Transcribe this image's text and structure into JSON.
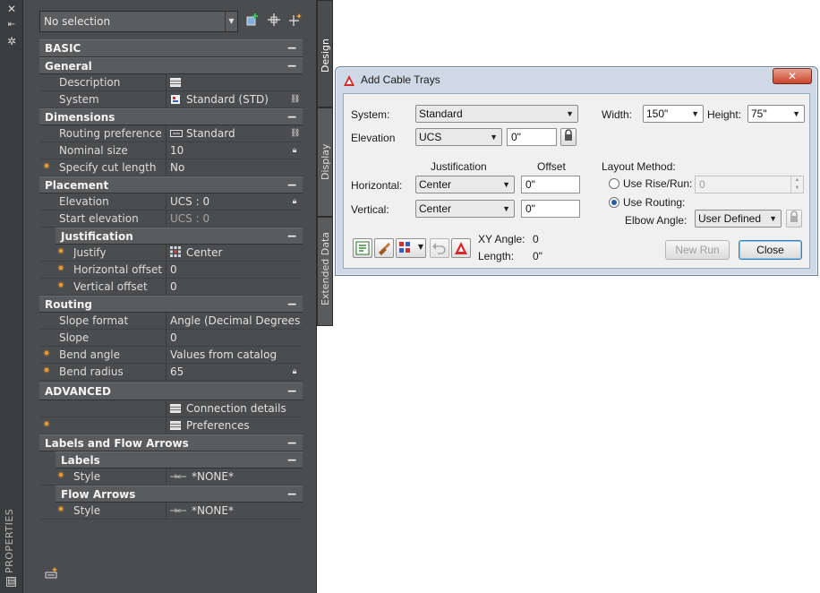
{
  "palette": {
    "vertical_title": "PROPERTIES",
    "selection": "No selection",
    "tabs": [
      "Design",
      "Display",
      "Extended Data"
    ],
    "sections": {
      "basic": "BASIC",
      "general": "General",
      "dimensions": "Dimensions",
      "placement": "Placement",
      "justification": "Justification",
      "routing": "Routing",
      "advanced": "ADVANCED",
      "labels_flow": "Labels and Flow Arrows",
      "labels": "Labels",
      "flow_arrows": "Flow Arrows"
    },
    "props": {
      "description": {
        "name": "Description",
        "value": ""
      },
      "system": {
        "name": "System",
        "value": "Standard (STD)"
      },
      "routing_pref": {
        "name": "Routing preference",
        "value": "Standard"
      },
      "nominal_size": {
        "name": "Nominal size",
        "value": "10"
      },
      "cut_length": {
        "name": "Specify cut length",
        "value": "No"
      },
      "elevation": {
        "name": "Elevation",
        "value": "UCS : 0"
      },
      "start_elevation": {
        "name": "Start elevation",
        "value": "UCS : 0"
      },
      "justify": {
        "name": "Justify",
        "value": "Center"
      },
      "h_offset": {
        "name": "Horizontal offset",
        "value": "0"
      },
      "v_offset": {
        "name": "Vertical offset",
        "value": "0"
      },
      "slope_format": {
        "name": "Slope format",
        "value": "Angle (Decimal Degrees)"
      },
      "slope": {
        "name": "Slope",
        "value": "0"
      },
      "bend_angle": {
        "name": "Bend angle",
        "value": "Values from catalog"
      },
      "bend_radius": {
        "name": "Bend radius",
        "value": "65"
      },
      "connection_details": {
        "value": "Connection details"
      },
      "preferences": {
        "value": "Preferences"
      },
      "labels_style": {
        "name": "Style",
        "value": "*NONE*"
      },
      "flow_style": {
        "name": "Style",
        "value": "*NONE*"
      }
    },
    "collapse_glyph": "−"
  },
  "dialog": {
    "title": "Add Cable Trays",
    "close_glyph": "✕",
    "system_label": "System:",
    "system_value": "Standard",
    "elevation_label": "Elevation",
    "elevation_ref": "UCS",
    "elevation_value": "0\"",
    "width_label": "Width:",
    "width_value": "150\"",
    "height_label": "Height:",
    "height_value": "75\"",
    "justification_header": "Justification",
    "offset_header": "Offset",
    "horizontal_label": "Horizontal:",
    "horizontal_just": "Center",
    "horizontal_offset": "0\"",
    "vertical_label": "Vertical:",
    "vertical_just": "Center",
    "vertical_offset": "0\"",
    "layout_method_label": "Layout Method:",
    "rise_run_label": "Use Rise/Run:",
    "rise_run_value": "0",
    "routing_label": "Use Routing:",
    "elbow_angle_label": "Elbow Angle:",
    "elbow_angle_value": "User Defined",
    "xy_angle_label": "XY Angle:",
    "xy_angle_value": "0",
    "length_label": "Length:",
    "length_value": "0\"",
    "new_run_button": "New Run",
    "close_button": "Close"
  }
}
